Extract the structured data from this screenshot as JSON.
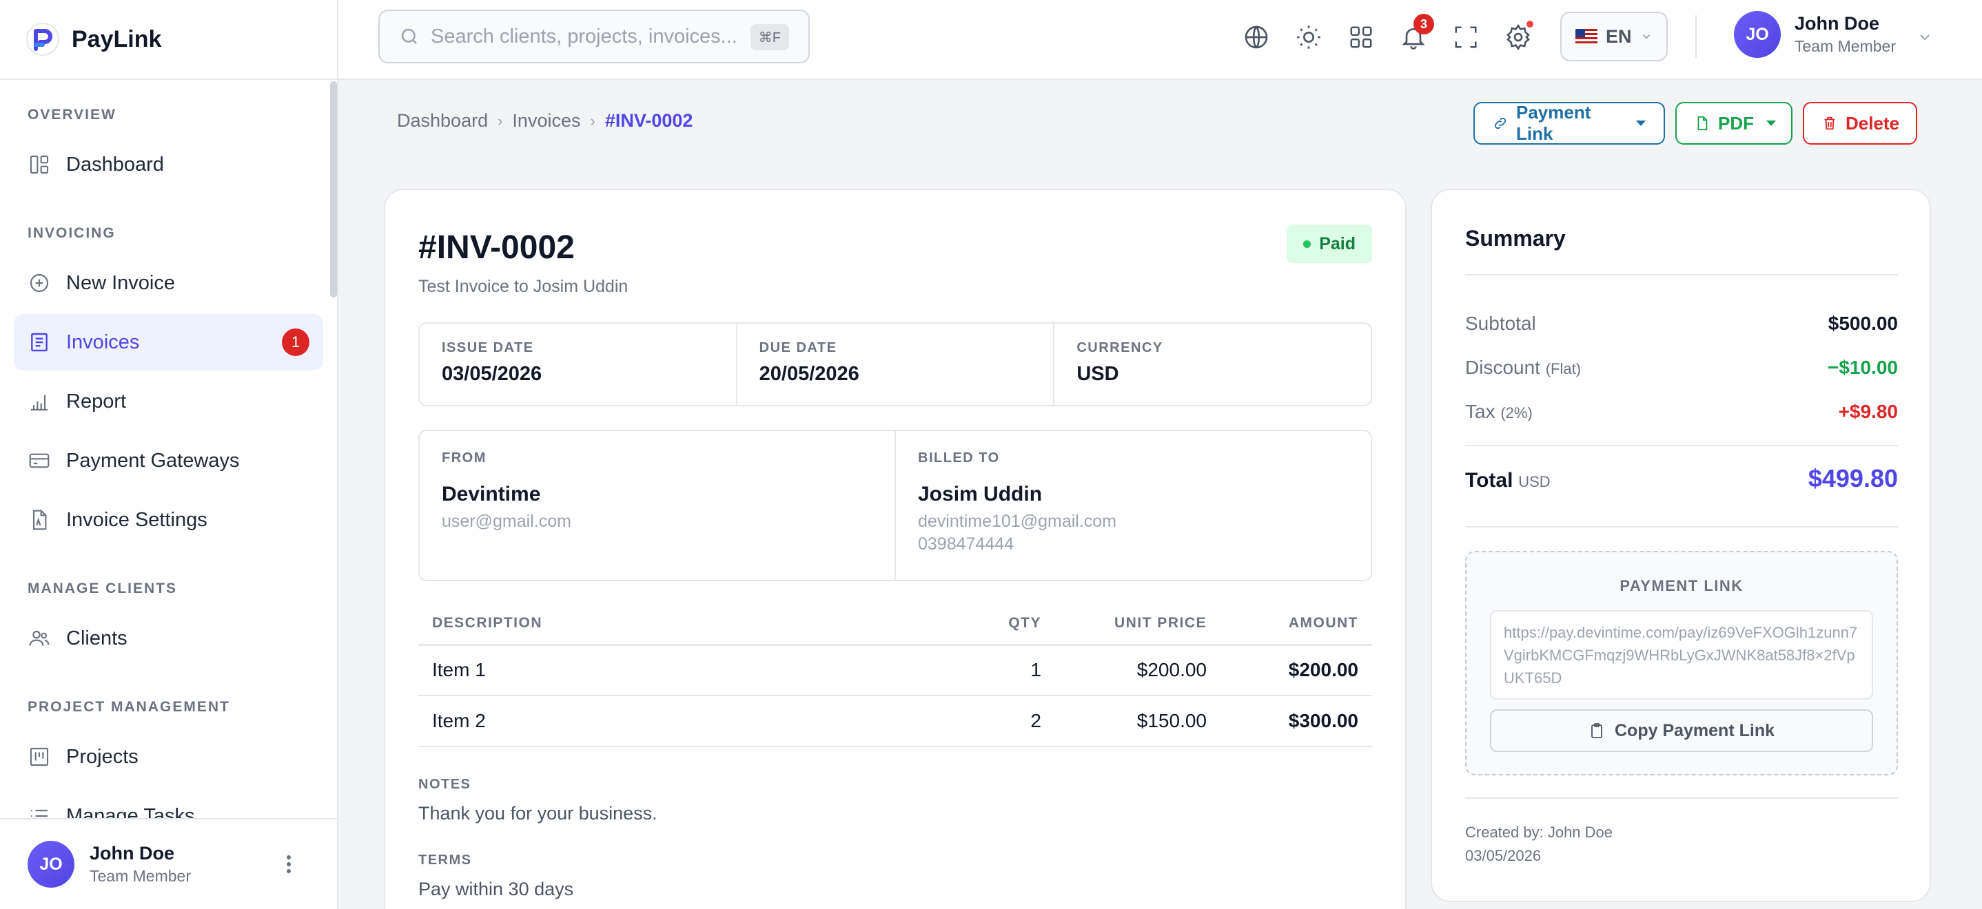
{
  "brand": {
    "name": "PayLink",
    "accent": "#4f46e5"
  },
  "sidebar": {
    "sections": [
      {
        "title": "OVERVIEW",
        "items": [
          {
            "label": "Dashboard",
            "icon": "dashboard-icon"
          }
        ]
      },
      {
        "title": "INVOICING",
        "items": [
          {
            "label": "New Invoice",
            "icon": "plus-circle-icon"
          },
          {
            "label": "Invoices",
            "icon": "invoice-icon",
            "active": true,
            "badge": "1"
          },
          {
            "label": "Report",
            "icon": "bar-chart-icon"
          },
          {
            "label": "Payment Gateways",
            "icon": "credit-card-icon"
          },
          {
            "label": "Invoice Settings",
            "icon": "file-settings-icon"
          }
        ]
      },
      {
        "title": "MANAGE CLIENTS",
        "items": [
          {
            "label": "Clients",
            "icon": "users-icon"
          }
        ]
      },
      {
        "title": "PROJECT MANAGEMENT",
        "items": [
          {
            "label": "Projects",
            "icon": "kanban-icon"
          },
          {
            "label": "Manage Tasks",
            "icon": "list-icon"
          }
        ]
      }
    ],
    "user": {
      "initials": "JO",
      "name": "John Doe",
      "role": "Team Member"
    }
  },
  "topbar": {
    "search_placeholder": "Search clients, projects, invoices...",
    "search_shortcut": "⌘F",
    "notification_count": "3",
    "language": "EN",
    "user": {
      "initials": "JO",
      "name": "John Doe",
      "role": "Team Member"
    }
  },
  "breadcrumb": {
    "items": [
      "Dashboard",
      "Invoices"
    ],
    "current": "#INV-0002"
  },
  "actions": {
    "payment_link": "Payment Link",
    "pdf": "PDF",
    "delete": "Delete"
  },
  "invoice": {
    "number": "#INV-0002",
    "subtitle": "Test Invoice to Josim Uddin",
    "status": "Paid",
    "issue_date_label": "ISSUE DATE",
    "issue_date": "03/05/2026",
    "due_date_label": "DUE DATE",
    "due_date": "20/05/2026",
    "currency_label": "CURRENCY",
    "currency": "USD",
    "from": {
      "label": "FROM",
      "name": "Devintime",
      "email": "user@gmail.com"
    },
    "billed_to": {
      "label": "BILLED TO",
      "name": "Josim Uddin",
      "email": "devintime101@gmail.com",
      "phone": "0398474444"
    },
    "columns": [
      "DESCRIPTION",
      "QTY",
      "UNIT PRICE",
      "AMOUNT"
    ],
    "items": [
      {
        "description": "Item 1",
        "qty": "1",
        "unit_price": "$200.00",
        "amount": "$200.00"
      },
      {
        "description": "Item 2",
        "qty": "2",
        "unit_price": "$150.00",
        "amount": "$300.00"
      }
    ],
    "notes_label": "NOTES",
    "notes": "Thank you for your business.",
    "terms_label": "TERMS",
    "terms": "Pay within 30 days"
  },
  "summary": {
    "title": "Summary",
    "subtotal_label": "Subtotal",
    "subtotal": "$500.00",
    "discount_label": "Discount",
    "discount_note": "(Flat)",
    "discount": "−$10.00",
    "tax_label": "Tax",
    "tax_note": "(2%)",
    "tax": "+$9.80",
    "total_label": "Total",
    "total_currency": "USD",
    "total": "$499.80",
    "payment_link_label": "PAYMENT LINK",
    "payment_link_url": "https://pay.devintime.com/pay/iz69VeFXOGlh1zunn7VgirbKMCGFmqzj9WHRbLyGxJWNK8at58Jf8×2fVpUKT65D",
    "copy_label": "Copy Payment Link",
    "created_by": "Created by: John Doe",
    "created_date": "03/05/2026"
  },
  "colors": {
    "discount": "#16a34a",
    "tax": "#dc2626",
    "total": "#4f46e5",
    "paid_bg": "#dcfce7",
    "paid_text": "#15803d"
  }
}
